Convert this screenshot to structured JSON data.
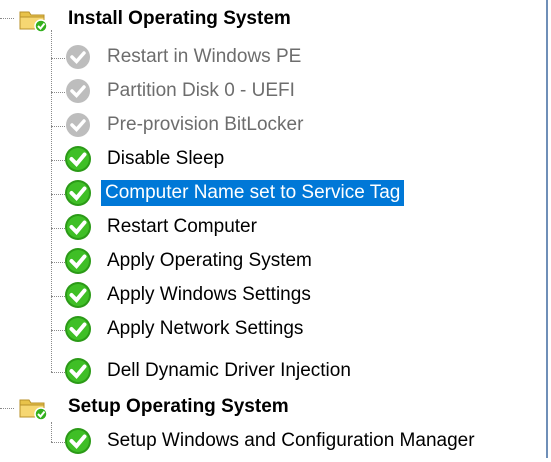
{
  "tree": {
    "groups": [
      {
        "label": "Install Operating System",
        "icon": "folder-icon",
        "steps": [
          {
            "label": "Restart in Windows PE",
            "icon": "disabled-check-icon",
            "state": "disabled"
          },
          {
            "label": "Partition Disk 0 - UEFI",
            "icon": "disabled-check-icon",
            "state": "disabled"
          },
          {
            "label": "Pre-provision BitLocker",
            "icon": "disabled-check-icon",
            "state": "disabled"
          },
          {
            "label": "Disable Sleep",
            "icon": "green-check-icon",
            "state": "enabled"
          },
          {
            "label": "Computer Name set to Service Tag",
            "icon": "green-check-icon",
            "state": "selected"
          },
          {
            "label": "Restart Computer",
            "icon": "green-check-icon",
            "state": "enabled"
          },
          {
            "label": "Apply Operating System",
            "icon": "green-check-icon",
            "state": "enabled"
          },
          {
            "label": "Apply Windows Settings",
            "icon": "green-check-icon",
            "state": "enabled"
          },
          {
            "label": "Apply Network Settings",
            "icon": "green-check-icon",
            "state": "enabled"
          },
          {
            "label": "Dell Dynamic Driver Injection",
            "icon": "green-check-icon",
            "state": "enabled"
          }
        ]
      },
      {
        "label": "Setup Operating System",
        "icon": "folder-icon",
        "steps": [
          {
            "label": "Setup Windows and Configuration Manager",
            "icon": "green-check-icon",
            "state": "enabled"
          }
        ]
      }
    ]
  },
  "colors": {
    "selection": "#0078d7",
    "check_green": "#33b01e",
    "disabled_text": "#6d6d6d",
    "folder": "#e8c24a"
  }
}
